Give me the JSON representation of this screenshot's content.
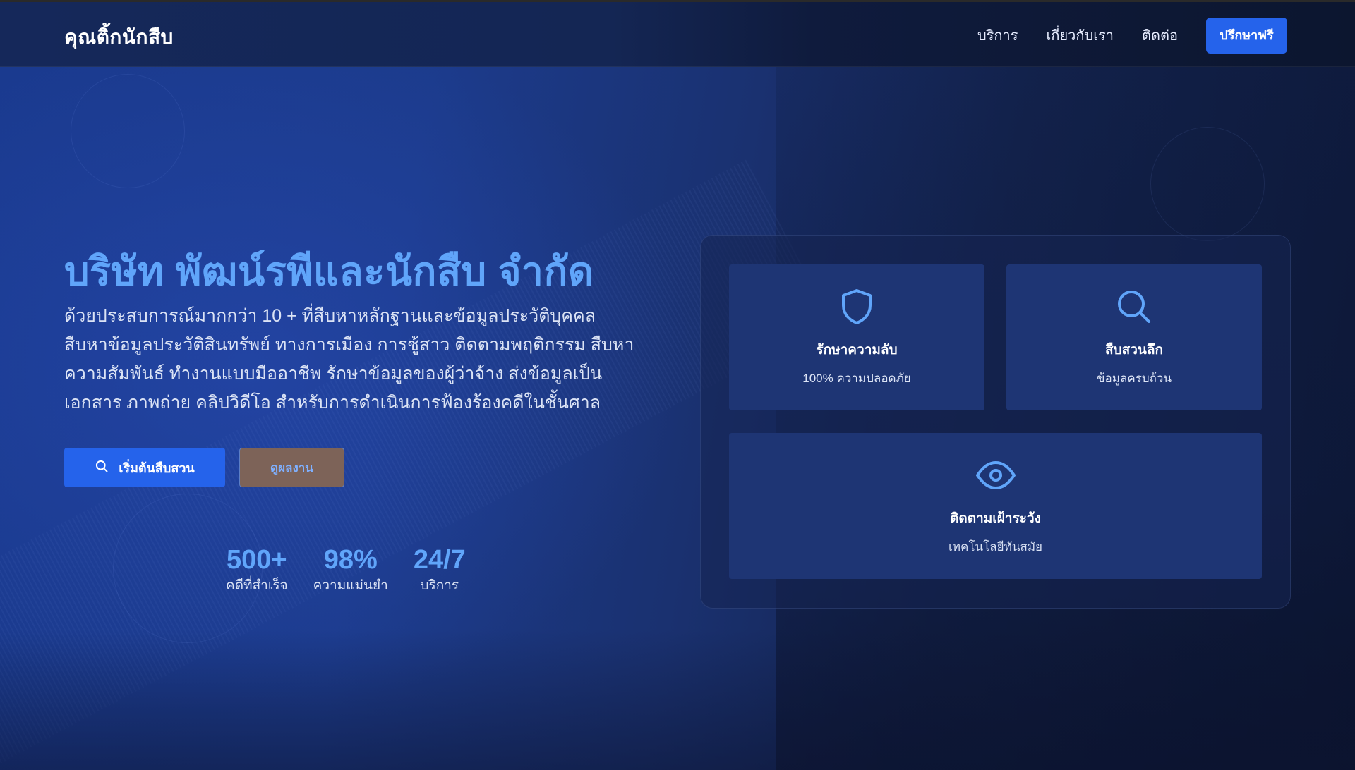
{
  "header": {
    "logo": "คุณติ้กนักสืบ",
    "nav": [
      "บริการ",
      "เกี่ยวกับเรา",
      "ติดต่อ"
    ],
    "cta": "ปรึกษาฟรี"
  },
  "hero": {
    "title": "บริษัท พัฒน์รพีและนักสืบ จำกัด",
    "description": "ด้วยประสบการณ์มากกว่า 10 + ที่สืบหาหลักฐานและข้อมูลประวัติบุคคล สืบหาข้อมูลประวัติสินทรัพย์ ทางการเมือง การชู้สาว ติดตามพฤติกรรม สืบหาความสัมพันธ์ ทำงานแบบมืออาชีพ รักษาข้อมูลของผู้ว่าจ้าง ส่งข้อมูลเป็นเอกสาร ภาพถ่าย คลิปวิดีโอ สำหรับการดำเนินการฟ้องร้องคดีในชั้นศาล",
    "primary_button": "เริ่มต้นสืบสวน",
    "secondary_button": "ดูผลงาน"
  },
  "stats": [
    {
      "value": "500+",
      "label": "คดีที่สำเร็จ"
    },
    {
      "value": "98%",
      "label": "ความแม่นยำ"
    },
    {
      "value": "24/7",
      "label": "บริการ"
    }
  ],
  "features": [
    {
      "icon": "shield-icon",
      "title": "รักษาความลับ",
      "subtitle": "100% ความปลอดภัย"
    },
    {
      "icon": "search-icon",
      "title": "สืบสวนลึก",
      "subtitle": "ข้อมูลครบถ้วน"
    },
    {
      "icon": "eye-icon",
      "title": "ติดตามเฝ้าระวัง",
      "subtitle": "เทคโนโลยีทันสมัย"
    }
  ],
  "colors": {
    "accent": "#2563eb",
    "highlight": "#60a5fa",
    "card": "#1e3574",
    "secondary_button": "#7d6358"
  }
}
